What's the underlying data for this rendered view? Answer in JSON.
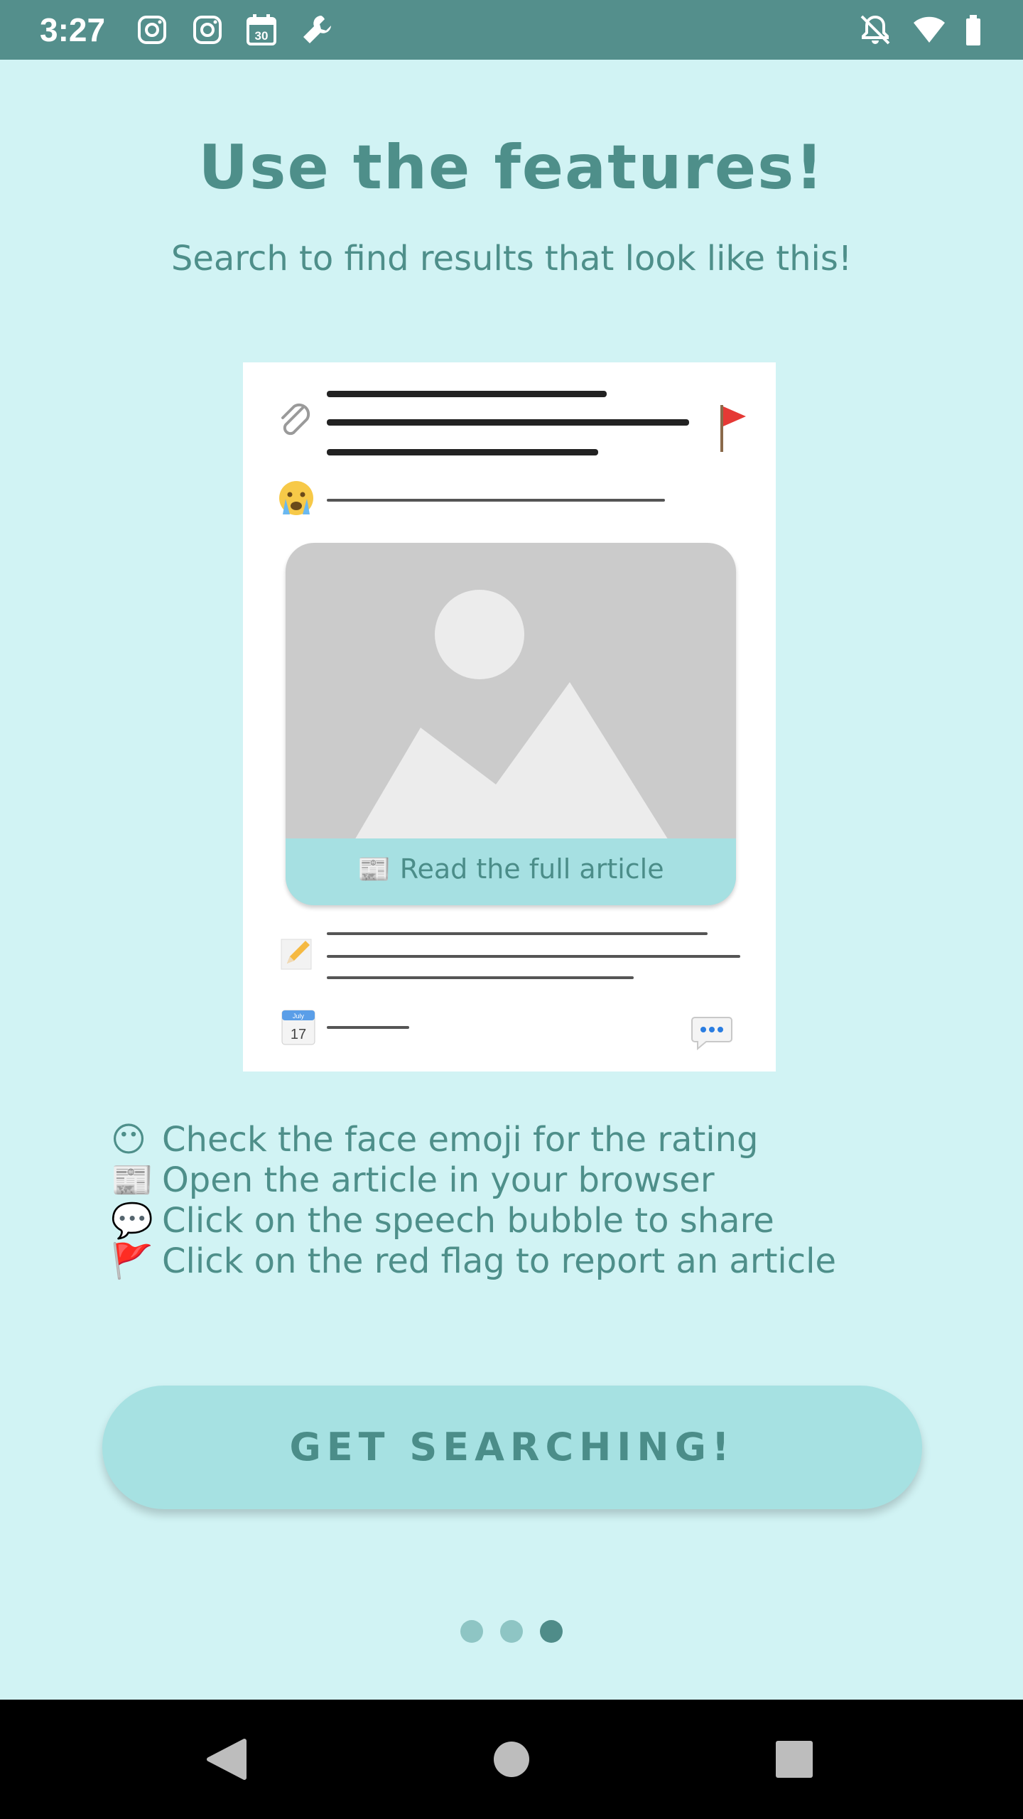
{
  "status_bar": {
    "time": "3:27",
    "left_icons": [
      "instagram-icon",
      "instagram-icon",
      "calendar-icon",
      "wrench-icon"
    ],
    "calendar_day": "30",
    "right_icons": [
      "notifications-off-icon",
      "wifi-icon",
      "battery-icon"
    ]
  },
  "onboarding": {
    "title": "Use the features!",
    "subtitle": "Search to find results that look like this!"
  },
  "illustration": {
    "read_article_label": "Read the full article",
    "calendar_month": "July",
    "calendar_day": "17"
  },
  "features": [
    {
      "icon": "😶",
      "icon_name": "neutral-face-icon",
      "text": "Check the face emoji for the rating"
    },
    {
      "icon": "📰",
      "icon_name": "newspaper-icon",
      "text": "Open the article in your browser"
    },
    {
      "icon": "💬",
      "icon_name": "speech-bubble-icon",
      "text": "Click on the speech bubble to share"
    },
    {
      "icon": "🚩",
      "icon_name": "red-flag-icon",
      "text": "Click on the red flag to report an article"
    }
  ],
  "cta": {
    "label": "GET SEARCHING!"
  },
  "pager": {
    "page_count": 3,
    "current_page": 3
  },
  "colors": {
    "background": "#d1f3f4",
    "status_bar": "#548f8c",
    "text": "#4e8f8a",
    "button": "#a6e1e2",
    "dot_inactive": "#8ec5c4",
    "dot_active": "#4f8c89"
  }
}
